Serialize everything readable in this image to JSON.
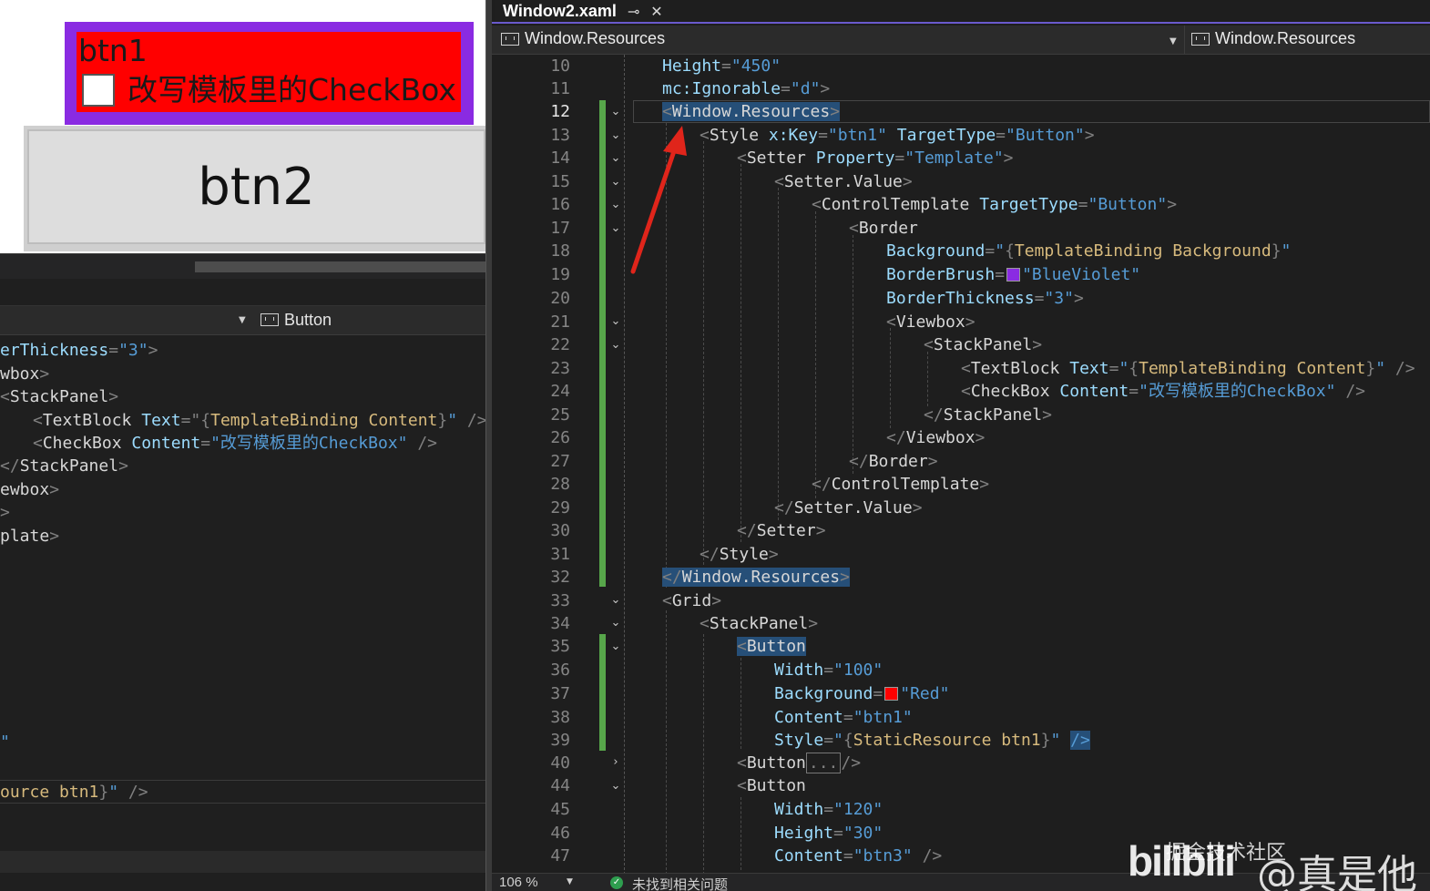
{
  "preview": {
    "btn1_text": "btn1",
    "checkbox_label": "改写模板里的CheckBox",
    "btn2_text": "btn2",
    "colors": {
      "btn1_background": "#ff0000",
      "btn1_border": "#8a2be2"
    }
  },
  "left_editor": {
    "nav_label": "Button",
    "code_lines": [
      "erThickness=\"3\">",
      "wbox>",
      "<StackPanel>",
      "  <TextBlock Text=\"{TemplateBinding Content}\" />",
      "  <CheckBox Content=\"改写模板里的CheckBox\" />",
      "</StackPanel>",
      "ewbox>",
      ">",
      "plate>"
    ],
    "bottom_fragment": "ource btn1}\" />",
    "orphan_quote": "\""
  },
  "tab": {
    "title": "Window2.xaml",
    "pin_icon": "pin-icon",
    "close_icon": "close-icon"
  },
  "navbar": {
    "left": "Window.Resources",
    "right": "Window.Resources"
  },
  "line_numbers": [
    "10",
    "11",
    "12",
    "13",
    "14",
    "15",
    "16",
    "17",
    "18",
    "19",
    "20",
    "21",
    "22",
    "23",
    "24",
    "25",
    "26",
    "27",
    "28",
    "29",
    "30",
    "31",
    "32",
    "33",
    "34",
    "35",
    "36",
    "37",
    "38",
    "39",
    "40",
    "44",
    "45",
    "46",
    "47"
  ],
  "code": {
    "l10_attr": "Height",
    "l10_val": "450",
    "l11_attr": "mc:Ignorable",
    "l11_val": "d",
    "l12_tag": "Window.Resources",
    "l13_tag": "Style",
    "l13_a1": "x:Key",
    "l13_v1": "btn1",
    "l13_a2": "TargetType",
    "l13_v2": "Button",
    "l14_tag": "Setter",
    "l14_a1": "Property",
    "l14_v1": "Template",
    "l15_tag": "Setter.Value",
    "l16_tag": "ControlTemplate",
    "l16_a1": "TargetType",
    "l16_v1": "Button",
    "l17_tag": "Border",
    "l18_attr": "Background",
    "l18_mk": "TemplateBinding",
    "l18_arg": "Background",
    "l19_attr": "BorderBrush",
    "l19_val": "BlueViolet",
    "l20_attr": "BorderThickness",
    "l20_val": "3",
    "l21_tag": "Viewbox",
    "l22_tag": "StackPanel",
    "l23_tag": "TextBlock",
    "l23_attr": "Text",
    "l23_mk": "TemplateBinding",
    "l23_arg": "Content",
    "l24_tag": "CheckBox",
    "l24_attr": "Content",
    "l24_val": "改写模板里的CheckBox",
    "l25_tag": "StackPanel",
    "l26_tag": "Viewbox",
    "l27_tag": "Border",
    "l28_tag": "ControlTemplate",
    "l29_tag": "Setter.Value",
    "l30_tag": "Setter",
    "l31_tag": "Style",
    "l32_tag": "Window.Resources",
    "l33_tag": "Grid",
    "l34_tag": "StackPanel",
    "l35_tag": "Button",
    "l36_attr": "Width",
    "l36_val": "100",
    "l37_attr": "Background",
    "l37_val": "Red",
    "l38_attr": "Content",
    "l38_val": "btn1",
    "l39_attr": "Style",
    "l39_mk": "StaticResource",
    "l39_arg": "btn1",
    "l40_tag": "Button",
    "l40_collapsed": "...",
    "l44_tag": "Button",
    "l45_attr": "Width",
    "l45_val": "120",
    "l46_attr": "Height",
    "l46_val": "30",
    "l47_attr": "Content",
    "l47_val": "btn3"
  },
  "swatch_colors": {
    "blueviolet": "#8a2be2",
    "red": "#ff0000"
  },
  "status": {
    "zoom": "106 %",
    "message": "未找到相关问题"
  },
  "watermark": {
    "logo": "bilibili",
    "small": "掘金技术社区",
    "big": "@真是他"
  }
}
